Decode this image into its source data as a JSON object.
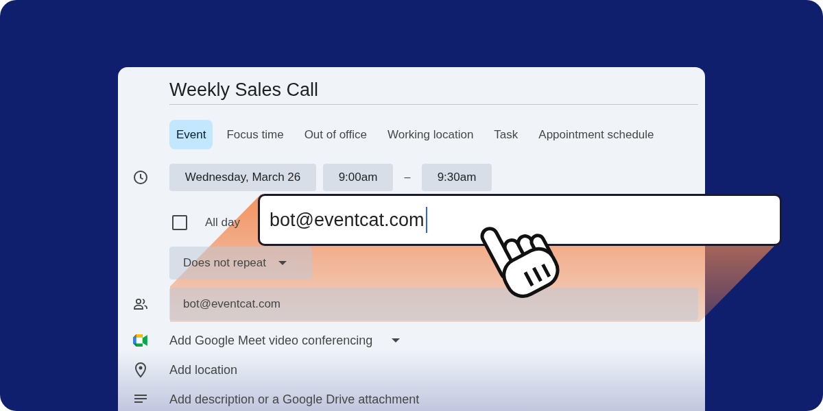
{
  "event": {
    "title": "Weekly Sales Call",
    "tabs": [
      {
        "label": "Event",
        "selected": true
      },
      {
        "label": "Focus time",
        "selected": false
      },
      {
        "label": "Out of office",
        "selected": false
      },
      {
        "label": "Working location",
        "selected": false
      },
      {
        "label": "Task",
        "selected": false
      },
      {
        "label": "Appointment schedule",
        "selected": false
      }
    ],
    "date": "Wednesday, March 26",
    "start_time": "9:00am",
    "separator": "–",
    "end_time": "9:30am",
    "all_day": {
      "label": "All day",
      "checked": false
    },
    "repeat": "Does not repeat",
    "guests": {
      "value": "bot@eventcat.com"
    },
    "meet": "Add Google Meet video conferencing",
    "location": "Add location",
    "description": "Add description or a Google Drive attachment"
  },
  "overlay_field": {
    "value": "bot@eventcat.com"
  }
}
